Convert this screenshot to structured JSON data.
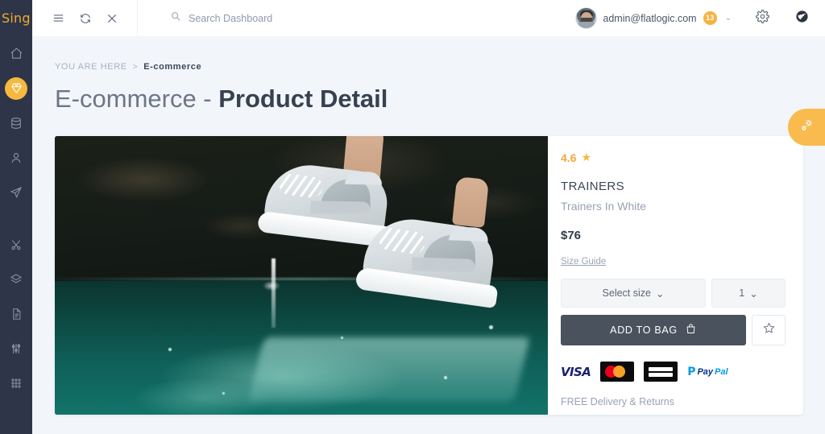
{
  "brand": {
    "logo_text": "Sing"
  },
  "header": {
    "menu_icon": "hamburger-icon",
    "refresh_icon": "refresh-icon",
    "close_icon": "close-icon",
    "search": {
      "placeholder": "Search Dashboard",
      "value": "",
      "icon": "search-icon"
    },
    "user": {
      "email": "admin@flatlogic.com",
      "badge_count": "13",
      "chevron": "⌄",
      "avatar": "user-avatar"
    },
    "settings_icon": "gear-icon",
    "globe_icon": "globe-icon"
  },
  "sidebar": {
    "items": [
      {
        "icon": "home-icon",
        "active": false
      },
      {
        "icon": "diamond-icon",
        "active": true
      },
      {
        "icon": "database-icon",
        "active": false
      },
      {
        "icon": "user-icon",
        "active": false
      },
      {
        "icon": "paper-plane-icon",
        "active": false
      },
      {
        "icon": "scissors-icon",
        "active": false
      },
      {
        "icon": "layers-icon",
        "active": false
      },
      {
        "icon": "document-icon",
        "active": false
      },
      {
        "icon": "sliders-icon",
        "active": false
      },
      {
        "icon": "grid-icon",
        "active": false
      }
    ]
  },
  "breadcrumb": {
    "prefix": "YOU ARE HERE",
    "separator": ">",
    "current": "E-commerce"
  },
  "page": {
    "title_light": "E-commerce - ",
    "title_bold": "Product Detail"
  },
  "settings_tab": {
    "icon": "gears-icon"
  },
  "product": {
    "image_alt": "white-trainers-over-water",
    "rating": "4.6",
    "rating_star": "★",
    "name": "TRAINERS",
    "subtitle": "Trainers In White",
    "price": "$76",
    "size_guide_link": "Size Guide",
    "size_select": {
      "label": "Select size",
      "chevron": "⌄"
    },
    "qty_select": {
      "label": "1",
      "chevron": "⌄"
    },
    "add_to_bag": {
      "label": "ADD TO BAG",
      "icon": "shopping-bag-icon"
    },
    "favorite": {
      "icon": "star-outline-icon"
    },
    "payments": [
      {
        "name": "visa-logo",
        "label": "VISA"
      },
      {
        "name": "mastercard-logo",
        "label": ""
      },
      {
        "name": "amex-logo",
        "label": ""
      },
      {
        "name": "paypal-logo",
        "label": "PayPal"
      }
    ],
    "delivery_note": "FREE Delivery & Returns"
  },
  "colors": {
    "accent_orange": "#f6b83f",
    "sidebar_bg": "#2e3549",
    "page_bg": "#f2f6fa",
    "button_dark": "#4a525d",
    "muted_text": "#98a2b3"
  }
}
